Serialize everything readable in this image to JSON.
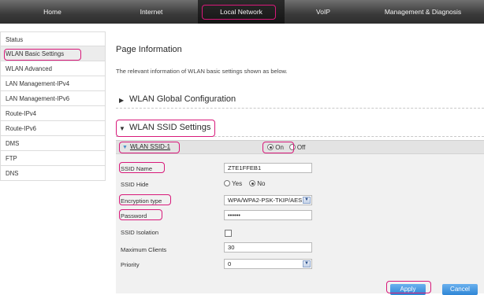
{
  "topnav": {
    "tabs": [
      {
        "label": "Home"
      },
      {
        "label": "Internet"
      },
      {
        "label": "Local Network"
      },
      {
        "label": "VoIP"
      },
      {
        "label": "Management & Diagnosis"
      }
    ],
    "active": "Local Network"
  },
  "sidebar": {
    "items": [
      {
        "label": "Status"
      },
      {
        "label": "WLAN Basic Settings"
      },
      {
        "label": "WLAN Advanced"
      },
      {
        "label": "LAN Management-IPv4"
      },
      {
        "label": "LAN Management-IPv6"
      },
      {
        "label": "Route-IPv4"
      },
      {
        "label": "Route-IPv6"
      },
      {
        "label": "DMS"
      },
      {
        "label": "FTP"
      },
      {
        "label": "DNS"
      }
    ],
    "active": "WLAN Basic Settings"
  },
  "main": {
    "page_title": "Page Information",
    "page_desc": "The relevant information of WLAN basic settings shown as below.",
    "section_global": "WLAN Global Configuration",
    "section_ssid": "WLAN SSID Settings",
    "ssid_link": "WLAN SSID-1",
    "on_label": "On",
    "off_label": "Off",
    "form": {
      "ssid_name_label": "SSID Name",
      "ssid_name_value": "ZTE1FFEB1",
      "ssid_hide_label": "SSID Hide",
      "yes_label": "Yes",
      "no_label": "No",
      "encryption_label": "Encryption type",
      "encryption_value": "WPA/WPA2-PSK-TKIP/AES",
      "password_label": "Password",
      "password_value": "••••••",
      "isolation_label": "SSID Isolation",
      "max_clients_label": "Maximum Clients",
      "max_clients_value": "30",
      "priority_label": "Priority",
      "priority_value": "0"
    },
    "apply_label": "Apply",
    "cancel_label": "Cancel"
  },
  "colors": {
    "highlight": "#d8197a",
    "button": "#2f86d6",
    "nav_bg": "#3a3a3a"
  }
}
